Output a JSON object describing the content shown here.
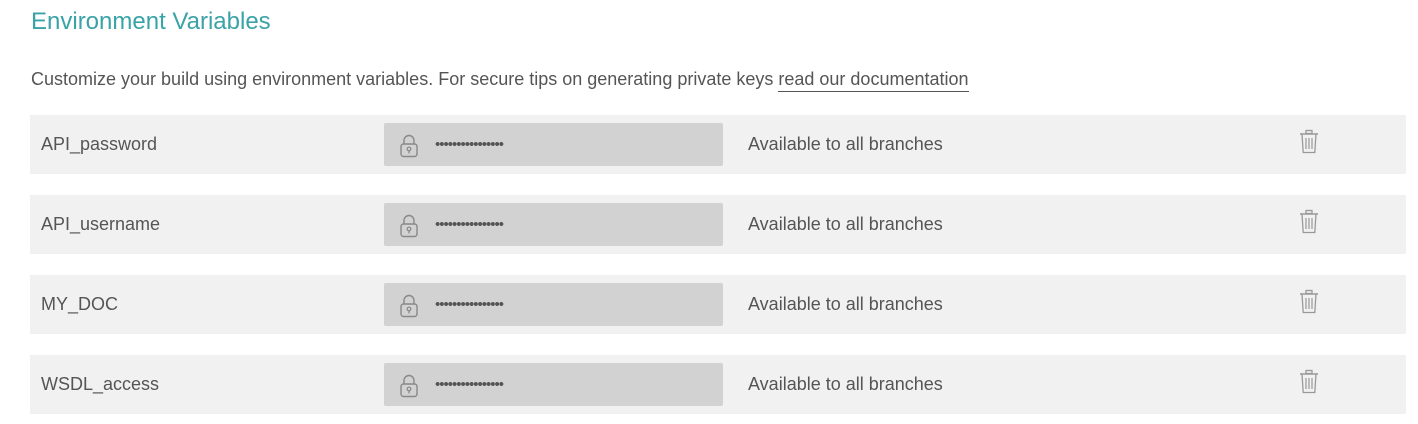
{
  "section": {
    "title": "Environment Variables",
    "intro_text": "Customize your build using environment variables. For secure tips on generating private keys ",
    "doc_link_label": "read our documentation"
  },
  "variables": [
    {
      "name": "API_password",
      "masked_value": "••••••••••••••••",
      "scope": "Available to all branches",
      "lock_icon": "lock-icon",
      "delete_icon": "trash-icon"
    },
    {
      "name": "API_username",
      "masked_value": "••••••••••••••••",
      "scope": "Available to all branches",
      "lock_icon": "lock-icon",
      "delete_icon": "trash-icon"
    },
    {
      "name": "MY_DOC",
      "masked_value": "••••••••••••••••",
      "scope": "Available to all branches",
      "lock_icon": "lock-icon",
      "delete_icon": "trash-icon"
    },
    {
      "name": "WSDL_access",
      "masked_value": "••••••••••••••••",
      "scope": "Available to all branches",
      "lock_icon": "lock-icon",
      "delete_icon": "trash-icon"
    }
  ],
  "colors": {
    "accent": "#3aa3a7",
    "text": "#555555",
    "row_bg": "#f1f1f1",
    "secret_bg": "#d2d2d2"
  }
}
